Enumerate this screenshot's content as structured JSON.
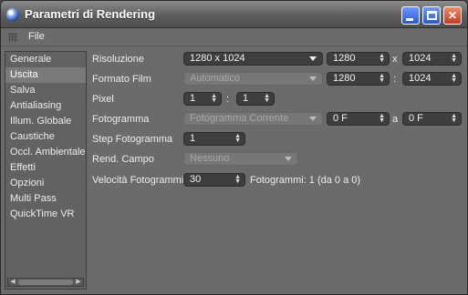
{
  "window": {
    "title": "Parametri di Rendering",
    "icon": "cinema4d-sphere-icon",
    "buttons": [
      "minimize-icon",
      "maximize-icon",
      "close-icon"
    ]
  },
  "menu": {
    "file": "File"
  },
  "sidebar": {
    "items": [
      {
        "label": "Generale"
      },
      {
        "label": "Uscita",
        "selected": true
      },
      {
        "label": "Salva"
      },
      {
        "label": "Antialiasing"
      },
      {
        "label": "Illum. Globale"
      },
      {
        "label": "Caustiche"
      },
      {
        "label": "Occl. Ambientale"
      },
      {
        "label": "Effetti"
      },
      {
        "label": "Opzioni"
      },
      {
        "label": "Multi Pass"
      },
      {
        "label": "QuickTime VR"
      }
    ]
  },
  "form": {
    "risoluzione": {
      "label": "Risoluzione",
      "preset": "1280 x 1024",
      "width": "1280",
      "sep": "x",
      "height": "1024"
    },
    "formato_film": {
      "label": "Formato Film",
      "preset": "Automatico",
      "width": "1280",
      "sep": ":",
      "height": "1024"
    },
    "pixel": {
      "label": "Pixel",
      "a": "1",
      "sep": ":",
      "b": "1"
    },
    "fotogramma": {
      "label": "Fotogramma",
      "preset": "Fotogramma Corrente",
      "from": "0 F",
      "sep": "a",
      "to": "0 F"
    },
    "step": {
      "label": "Step Fotogramma",
      "value": "1"
    },
    "rend_campo": {
      "label": "Rend. Campo",
      "value": "Nessuno"
    },
    "velocita": {
      "label": "Velocità Fotogrammi",
      "value": "30",
      "info": "Fotogrammi: 1 (da 0 a 0)"
    }
  },
  "colors": {
    "window_bg": "#6b6b6b",
    "field_bg": "#3e3e3e",
    "selection": "#7a7a7a",
    "close_button": "#c93b1f",
    "title_button": "#2757d8"
  }
}
